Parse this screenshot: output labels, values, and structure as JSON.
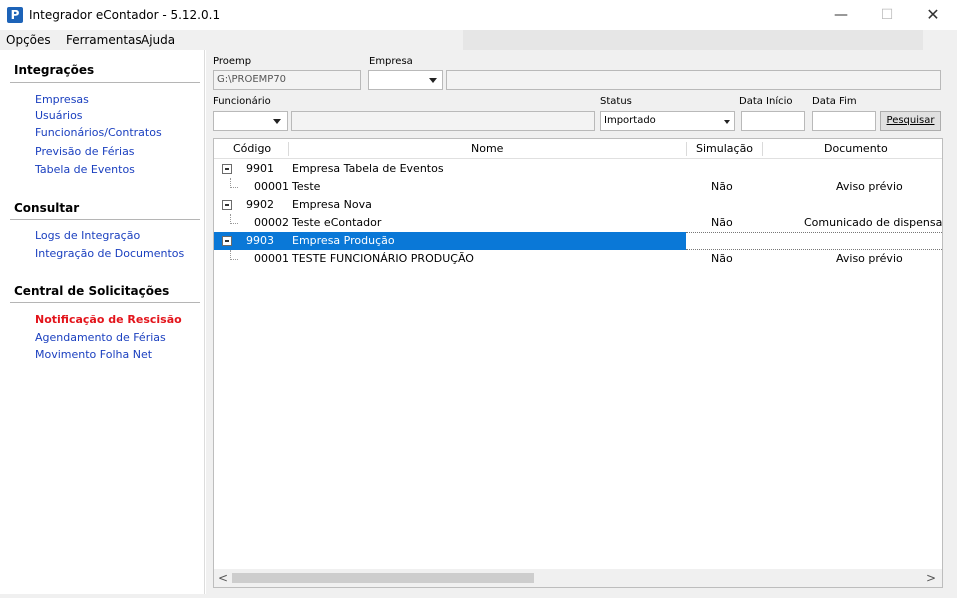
{
  "window": {
    "title": "Integrador eContador - 5.12.0.1",
    "app_icon_letter": "P",
    "min_glyph": "—",
    "max_glyph": "☐",
    "close_glyph": "✕"
  },
  "menu": [
    "Opções",
    "Ferramentas",
    "Ajuda"
  ],
  "sidebar": {
    "sections": [
      {
        "title": "Integrações",
        "items": [
          "Empresas",
          "Usuários",
          "Funcionários/Contratos",
          "Previsão de Férias",
          "Tabela de Eventos"
        ]
      },
      {
        "title": "Consultar",
        "items": [
          "Logs de Integração",
          "Integração de Documentos"
        ]
      },
      {
        "title": "Central de Solicitações",
        "items": [
          "Notificação de Rescisão",
          "Agendamento de Férias",
          "Movimento Folha Net"
        ]
      }
    ],
    "active_item": "Notificação de Rescisão",
    "active_color": "#e3141b",
    "link_color": "#1a3fbf"
  },
  "filters": {
    "proemp_label": "Proemp",
    "proemp_value": "G:\\PROEMP70",
    "empresa_label": "Empresa",
    "empresa_value": "",
    "empresa_name": "",
    "funcionario_label": "Funcionário",
    "funcionario_value": "",
    "funcionario_name": "",
    "status_label": "Status",
    "status_value": "Importado",
    "data_inicio_label": "Data Início",
    "data_inicio_value": "",
    "data_fim_label": "Data Fim",
    "data_fim_value": "",
    "search_button": "Pesquisar"
  },
  "grid": {
    "columns": [
      "Código",
      "Nome",
      "Simulação",
      "Documento"
    ],
    "rows": [
      {
        "type": "group",
        "code": "9901",
        "name": "Empresa Tabela de Eventos",
        "simulacao": "",
        "documento": ""
      },
      {
        "type": "child",
        "code": "00001",
        "name": "Teste",
        "simulacao": "Não",
        "documento": "Aviso prévio"
      },
      {
        "type": "group",
        "code": "9902",
        "name": "Empresa Nova",
        "simulacao": "",
        "documento": ""
      },
      {
        "type": "child",
        "code": "00002",
        "name": "Teste eContador",
        "simulacao": "Não",
        "documento": "Comunicado de dispensa"
      },
      {
        "type": "group",
        "code": "9903",
        "name": "Empresa Produção",
        "simulacao": "",
        "documento": "",
        "selected": true
      },
      {
        "type": "child",
        "code": "00001",
        "name": "TESTE FUNCIONÁRIO PRODUÇÃO",
        "simulacao": "Não",
        "documento": "Aviso prévio"
      }
    ],
    "selection_color": "#0a78d7",
    "scroll_left_glyph": "<",
    "scroll_right_glyph": ">"
  }
}
